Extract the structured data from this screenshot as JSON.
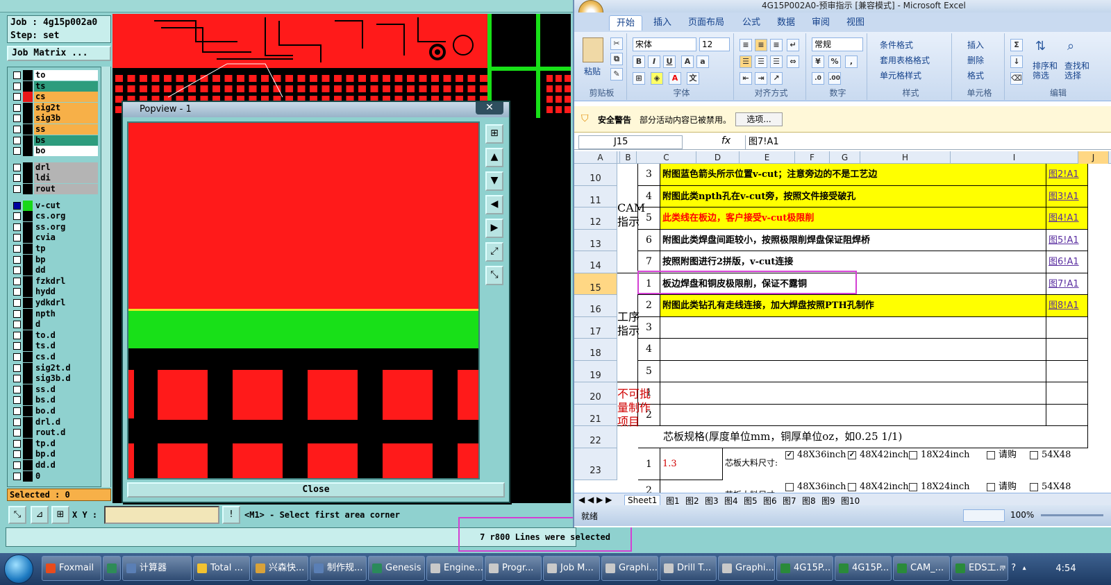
{
  "cam": {
    "job_label": "Job : 4g15p002a0",
    "step_label": "Step: set",
    "job_matrix": "Job Matrix ...",
    "layers": [
      {
        "name": "to",
        "color": "#ffffff",
        "swatch": "#000000",
        "checked": false
      },
      {
        "name": "ts",
        "color": "#2e9c7d",
        "swatch": "#000000",
        "checked": false
      },
      {
        "name": "cs",
        "color": "#f7b048",
        "swatch": "#e81818",
        "checked": false
      },
      {
        "name": "sig2t",
        "color": "#f7b048",
        "swatch": "#000000",
        "checked": false
      },
      {
        "name": "sig3b",
        "color": "#f7b048",
        "swatch": "#000000",
        "checked": false
      },
      {
        "name": "ss",
        "color": "#f7b048",
        "swatch": "#000000",
        "checked": false
      },
      {
        "name": "bs",
        "color": "#2e9c7d",
        "swatch": "#000000",
        "checked": false
      },
      {
        "name": "bo",
        "color": "#ffffff",
        "swatch": "#000000",
        "checked": false
      },
      {
        "name": "drl",
        "color": "#b4b4b4",
        "swatch": "#000000",
        "checked": false
      },
      {
        "name": "ldi",
        "color": "#b4b4b4",
        "swatch": "#000000",
        "checked": false
      },
      {
        "name": "rout",
        "color": "#b4b4b4",
        "swatch": "#000000",
        "checked": false
      },
      {
        "name": "v-cut",
        "color": "#8fd1cf",
        "swatch": "#18d818",
        "checked": true
      },
      {
        "name": "cs.org",
        "color": "#8fd1cf",
        "swatch": "#000000",
        "checked": false
      },
      {
        "name": "ss.org",
        "color": "#8fd1cf",
        "swatch": "#000000",
        "checked": false
      },
      {
        "name": "cvia",
        "color": "#8fd1cf",
        "swatch": "#000000",
        "checked": false
      },
      {
        "name": "tp",
        "color": "#8fd1cf",
        "swatch": "#000000",
        "checked": false
      },
      {
        "name": "bp",
        "color": "#8fd1cf",
        "swatch": "#000000",
        "checked": false
      },
      {
        "name": "dd",
        "color": "#8fd1cf",
        "swatch": "#000000",
        "checked": false
      },
      {
        "name": "fzkdrl",
        "color": "#8fd1cf",
        "swatch": "#000000",
        "checked": false
      },
      {
        "name": "hydd",
        "color": "#8fd1cf",
        "swatch": "#000000",
        "checked": false
      },
      {
        "name": "ydkdrl",
        "color": "#8fd1cf",
        "swatch": "#000000",
        "checked": false
      },
      {
        "name": "npth",
        "color": "#8fd1cf",
        "swatch": "#000000",
        "checked": false
      },
      {
        "name": "d",
        "color": "#8fd1cf",
        "swatch": "#000000",
        "checked": false
      },
      {
        "name": "to.d",
        "color": "#8fd1cf",
        "swatch": "#000000",
        "checked": false
      },
      {
        "name": "ts.d",
        "color": "#8fd1cf",
        "swatch": "#000000",
        "checked": false
      },
      {
        "name": "cs.d",
        "color": "#8fd1cf",
        "swatch": "#000000",
        "checked": false
      },
      {
        "name": "sig2t.d",
        "color": "#8fd1cf",
        "swatch": "#000000",
        "checked": false
      },
      {
        "name": "sig3b.d",
        "color": "#8fd1cf",
        "swatch": "#000000",
        "checked": false
      },
      {
        "name": "ss.d",
        "color": "#8fd1cf",
        "swatch": "#000000",
        "checked": false
      },
      {
        "name": "bs.d",
        "color": "#8fd1cf",
        "swatch": "#000000",
        "checked": false
      },
      {
        "name": "bo.d",
        "color": "#8fd1cf",
        "swatch": "#000000",
        "checked": false
      },
      {
        "name": "drl.d",
        "color": "#8fd1cf",
        "swatch": "#000000",
        "checked": false
      },
      {
        "name": "rout.d",
        "color": "#8fd1cf",
        "swatch": "#000000",
        "checked": false
      },
      {
        "name": "tp.d",
        "color": "#8fd1cf",
        "swatch": "#000000",
        "checked": false
      },
      {
        "name": "bp.d",
        "color": "#8fd1cf",
        "swatch": "#000000",
        "checked": false
      },
      {
        "name": "dd.d",
        "color": "#8fd1cf",
        "swatch": "#000000",
        "checked": false
      },
      {
        "name": "0",
        "color": "#8fd1cf",
        "swatch": "#000000",
        "checked": false
      }
    ],
    "selected_label": "Selected : 0",
    "popview_title": "Popview - 1",
    "popview_close": "Close",
    "xy_label": "X Y :",
    "xy_value": "",
    "prompt": "<M1> - Select first area corner",
    "status": "7 r800 Lines were selected",
    "colors": {
      "copper": "#ff1a1a",
      "vcut": "#18e018",
      "background": "#000000"
    }
  },
  "excel": {
    "title": "4G15P002A0-预审指示 [兼容模式] - Microsoft Excel",
    "tabs": [
      "开始",
      "插入",
      "页面布局",
      "公式",
      "数据",
      "审阅",
      "视图"
    ],
    "ribbon": {
      "paste": "粘贴",
      "clipboard": "剪贴板",
      "font_name": "宋体",
      "font_size": "12",
      "font_group": "字体",
      "align_group": "对齐方式",
      "number_format": "常规",
      "number_group": "数字",
      "cond_format": "条件格式",
      "table_format": "套用表格格式",
      "cell_style": "单元格样式",
      "style_group": "样式",
      "insert": "插入",
      "delete": "删除",
      "format": "格式",
      "cells_group": "单元格",
      "sort_filter": "排序和筛选",
      "find_select": "查找和选择",
      "edit_group": "编辑"
    },
    "security": {
      "label": "安全警告",
      "message": "部分活动内容已被禁用。",
      "options": "选项..."
    },
    "name_box": "J15",
    "formula": "图7!A1",
    "columns": [
      "A",
      "B",
      "C",
      "D",
      "E",
      "F",
      "G",
      "H",
      "I",
      "J"
    ],
    "rows": [
      {
        "n": "10",
        "b": "3",
        "text": "附图蓝色箭头所示位置v-cut；注意旁边的不是工艺边",
        "link": "图2!A1",
        "fill": "#ffff00",
        "color": "#000000"
      },
      {
        "n": "11",
        "b": "4",
        "text": "附图此类npth孔在v-cut旁，按照文件接受破孔",
        "link": "图3!A1",
        "fill": "#ffff00",
        "color": "#000000"
      },
      {
        "n": "12",
        "b": "5",
        "text": "此类线在板边，客户接受v-cut极限削",
        "link": "图4!A1",
        "fill": "#ffff00",
        "color": "#ff0000"
      },
      {
        "n": "13",
        "b": "6",
        "text": "附图此类焊盘间距较小，按照极限削焊盘保证阻焊桥",
        "link": "图5!A1",
        "fill": "#ffffff",
        "color": "#000000"
      },
      {
        "n": "14",
        "b": "7",
        "text": "按照附图进行2拼版，v-cut连接",
        "link": "图6!A1",
        "fill": "#ffffff",
        "color": "#000000"
      },
      {
        "n": "15",
        "b": "1",
        "text": "板边焊盘和铜皮极限削，保证不露铜",
        "link": "图7!A1",
        "fill": "#ffffff",
        "color": "#000000"
      },
      {
        "n": "16",
        "b": "2",
        "text": "附图此类钻孔有走线连接，加大焊盘按照PTH孔制作",
        "link": "图8!A1",
        "fill": "#ffff00",
        "color": "#000000"
      },
      {
        "n": "17",
        "b": "3",
        "text": "",
        "link": "",
        "fill": "#ffffff",
        "color": "#000000"
      },
      {
        "n": "18",
        "b": "4",
        "text": "",
        "link": "",
        "fill": "#ffffff",
        "color": "#000000"
      },
      {
        "n": "19",
        "b": "5",
        "text": "",
        "link": "",
        "fill": "#ffffff",
        "color": "#000000"
      },
      {
        "n": "20",
        "b": "1",
        "text": "",
        "link": "",
        "fill": "#ffffff",
        "color": "#000000"
      },
      {
        "n": "21",
        "b": "2",
        "text": "",
        "link": "",
        "fill": "#ffffff",
        "color": "#000000"
      }
    ],
    "group_cam": "CAM\n指示",
    "group_process": "工序\n指示",
    "group_nobatch": "不可批\n量制作\n项目",
    "row22": {
      "n": "22",
      "text": "芯板规格(厚度单位mm，铜厚单位oz，如0.25 1/1)"
    },
    "row23": {
      "n": "23",
      "b": "1",
      "thick": "1.3",
      "label": "芯板大料尺寸:",
      "opt1": "48X36inch",
      "opt2": "48X42inch",
      "opt3": "18X24inch",
      "opt4": "请购",
      "opt5": "54X48"
    },
    "row24": {
      "b": "2",
      "label": "芯板大料尺寸:",
      "opt1": "48X36inch",
      "opt2": "48X42inch",
      "opt3": "18X24inch",
      "opt4": "请购",
      "opt5": "54X48"
    },
    "sheet_tabs": [
      "Sheet1",
      "图1",
      "图2",
      "图3",
      "图4",
      "图5",
      "图6",
      "图7",
      "图8",
      "图9",
      "图10"
    ],
    "status_ready": "就绪",
    "zoom": "100%"
  },
  "taskbar": {
    "items": [
      {
        "label": "Foxmail",
        "color": "#e84b1c"
      },
      {
        "label": "",
        "color": "#2e8b57"
      },
      {
        "label": "计算器",
        "color": "#5a7fb5"
      },
      {
        "label": "Total ...",
        "color": "#f2c230"
      },
      {
        "label": "兴森快...",
        "color": "#d8a23a"
      },
      {
        "label": "制作规...",
        "color": "#5a7fb5"
      },
      {
        "label": "Genesis",
        "color": "#2a8a5a"
      },
      {
        "label": "Engine...",
        "color": "#c9c9c9"
      },
      {
        "label": "Progr...",
        "color": "#c9c9c9"
      },
      {
        "label": "Job M...",
        "color": "#c9c9c9"
      },
      {
        "label": "Graphi...",
        "color": "#c9c9c9"
      },
      {
        "label": "Drill T...",
        "color": "#c9c9c9"
      },
      {
        "label": "Graphi...",
        "color": "#c9c9c9"
      },
      {
        "label": "4G15P...",
        "color": "#2a8a3a"
      },
      {
        "label": "4G15P...",
        "color": "#2a8a3a"
      },
      {
        "label": "CAM_...",
        "color": "#2a8a3a"
      },
      {
        "label": "EDS工...",
        "color": "#2a8a3a"
      }
    ],
    "clock": "4:54"
  }
}
